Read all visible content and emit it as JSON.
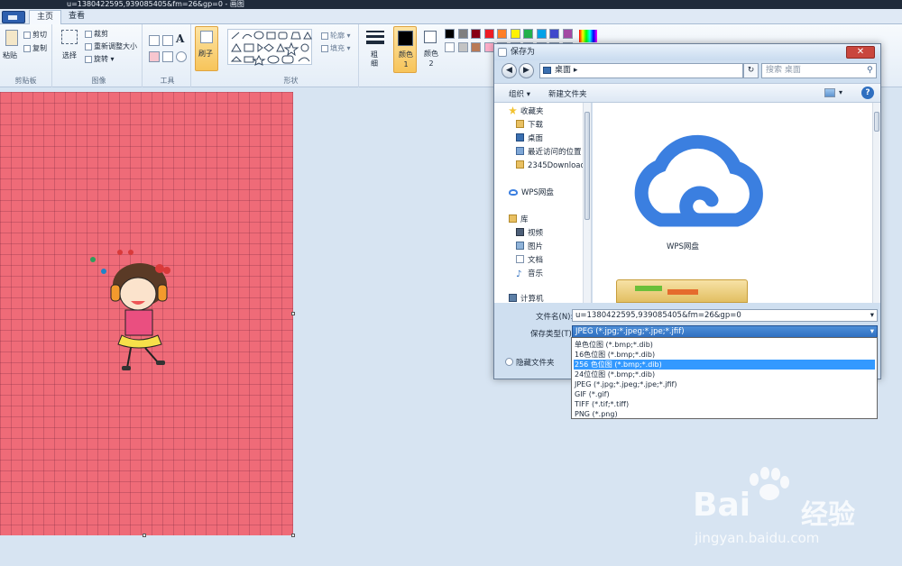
{
  "window": {
    "title": "u=1380422595,939085405&fm=26&gp=0 - 画图"
  },
  "tabs": [
    "主页",
    "查看"
  ],
  "ribbon": {
    "clipboard": {
      "paste": "粘贴",
      "cut": "剪切",
      "copy": "复制",
      "label": "剪贴板"
    },
    "image": {
      "select": "选择",
      "crop": "裁剪",
      "resize": "重新调整大小",
      "rotate": "旋转",
      "label": "图像"
    },
    "tools": {
      "label": "工具",
      "text_tool": "A"
    },
    "brush": {
      "label": "刷子"
    },
    "shapes": {
      "outline": "轮廓",
      "fill": "填充",
      "label": "形状"
    },
    "size": {
      "label": "粗细"
    },
    "color1": {
      "label": "颜色 1",
      "value": "#000000"
    },
    "color2": {
      "label": "颜色 2",
      "value": "#ffffff"
    },
    "palette": [
      "#000000",
      "#7f7f7f",
      "#880015",
      "#ed1c24",
      "#ff7f27",
      "#fff200",
      "#22b14c",
      "#00a2e8",
      "#3f48cc",
      "#a349a4",
      "#ffffff",
      "#c3c3c3",
      "#b97a57",
      "#ffaec9",
      "#ffc90e",
      "#efe4b0",
      "#b5e61d",
      "#99d9ea",
      "#7092be",
      "#c8bfe7"
    ]
  },
  "dialog": {
    "title": "保存为",
    "close": "✕",
    "back": "◀",
    "forward": "▶",
    "location": "桌面",
    "refresh": "↻",
    "search_placeholder": "搜索 桌面",
    "organize": "组织 ▾",
    "new_folder": "新建文件夹",
    "help": "?",
    "nav": {
      "favorites": "收藏夹",
      "downloads": "下载",
      "desktop": "桌面",
      "recent": "最近访问的位置",
      "folder_2345": "2345Downloads",
      "wps": "WPS网盘",
      "libraries": "库",
      "videos": "视频",
      "pictures": "图片",
      "documents": "文档",
      "music": "音乐",
      "computer": "计算机"
    },
    "content": {
      "wps_label": "WPS网盘"
    },
    "filename_label": "文件名(N):",
    "filename": "u=1380422595,939085405&fm=26&gp=0",
    "filetype_label": "保存类型(T):",
    "filetype": "JPEG (*.jpg;*.jpeg;*.jpe;*.jfif)",
    "hide_folders": "隐藏文件夹",
    "filetype_options": [
      "单色位图 (*.bmp;*.dib)",
      "16色位图 (*.bmp;*.dib)",
      "256 色位图 (*.bmp;*.dib)",
      "24位位图 (*.bmp;*.dib)",
      "JPEG (*.jpg;*.jpeg;*.jpe;*.jfif)",
      "GIF (*.gif)",
      "TIFF (*.tif;*.tiff)",
      "PNG (*.png)"
    ],
    "selected_option": 2
  },
  "watermark": {
    "brand": "Bai",
    "brand2": "经验",
    "url": "jingyan.baidu.com"
  },
  "colors": {
    "canvas": "#ef6b78",
    "accent": "#3399ff",
    "wps_cloud": "#3b7fe0"
  }
}
